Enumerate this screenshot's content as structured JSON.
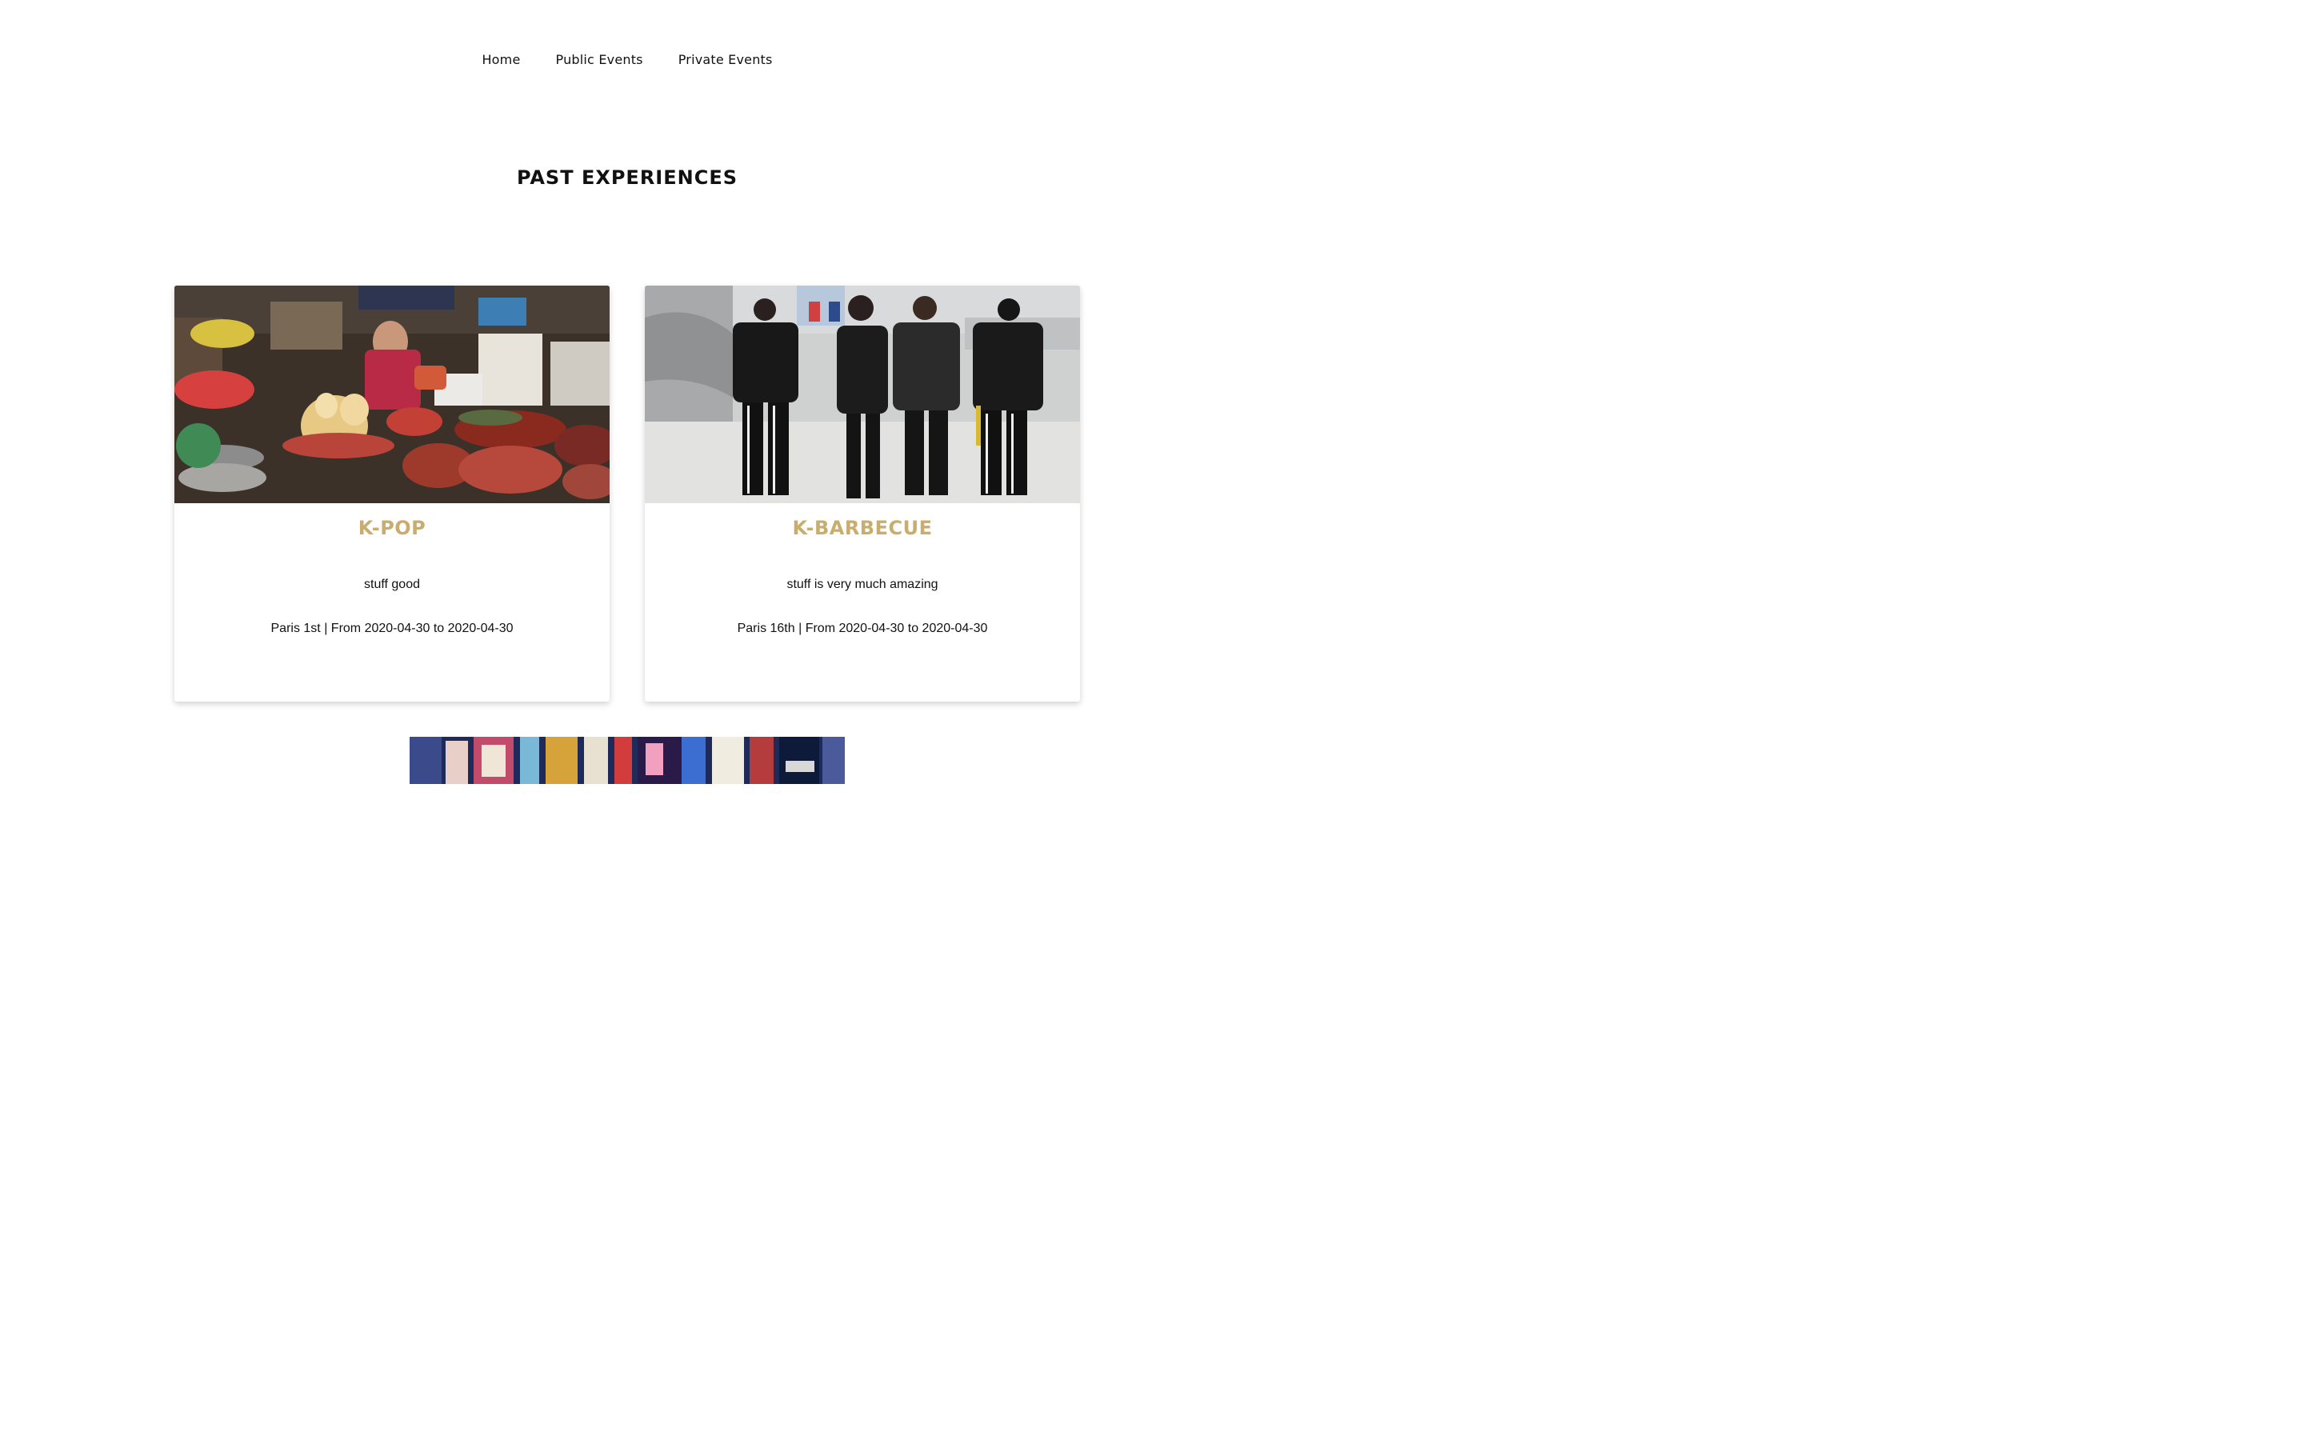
{
  "nav": {
    "items": [
      {
        "label": "Home"
      },
      {
        "label": "Public Events"
      },
      {
        "label": "Private Events"
      }
    ]
  },
  "page": {
    "title": "PAST EXPERIENCES"
  },
  "colors": {
    "accent": "#c9ad6e",
    "text": "#111111",
    "background": "#ffffff"
  },
  "cards": [
    {
      "title": "K-POP",
      "description": "stuff good",
      "meta": "Paris 1st | From 2020-04-30 to 2020-04-30",
      "image": "market-vendor-photo"
    },
    {
      "title": "K-BARBECUE",
      "description": "stuff is very much amazing",
      "meta": "Paris 16th | From 2020-04-30 to 2020-04-30",
      "image": "street-fashion-group-photo"
    },
    {
      "image": "neon-street-signs-photo"
    }
  ]
}
